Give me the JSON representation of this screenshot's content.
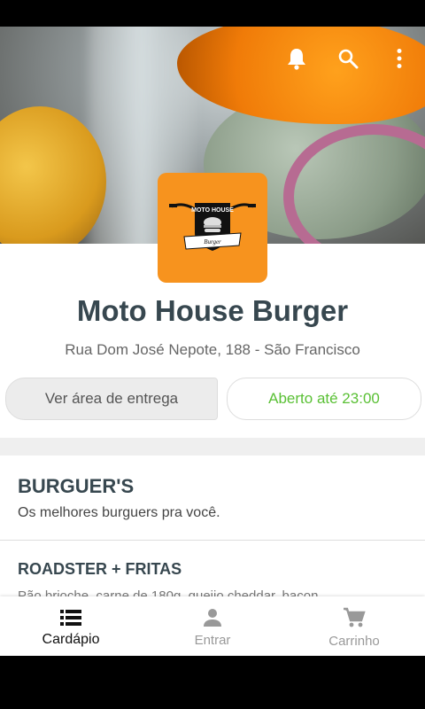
{
  "store": {
    "name": "Moto House Burger",
    "address": "Rua Dom José Nepote, 188 - São Francisco",
    "delivery_button": "Ver área de entrega",
    "hours_status": "Aberto até 23:00",
    "logo_text_top": "MOTO HOUSE",
    "logo_text_bottom": "Burger"
  },
  "colors": {
    "brand_orange": "#f7931e",
    "title_dark": "#37474f",
    "open_green": "#5ac035"
  },
  "top_actions": [
    "bell-icon",
    "search-icon",
    "more-vertical-icon"
  ],
  "category": {
    "title": "BURGUER'S",
    "subtitle": "Os melhores burguers pra você."
  },
  "product": {
    "title": "ROADSTER + FRITAS",
    "desc": "Pão brioche, carne de 180g, queijo cheddar, bacon..."
  },
  "bottom_nav": {
    "items": [
      {
        "label": "Cardápio",
        "icon": "menu-list-icon"
      },
      {
        "label": "Entrar",
        "icon": "person-icon"
      },
      {
        "label": "Carrinho",
        "icon": "cart-icon"
      }
    ]
  }
}
